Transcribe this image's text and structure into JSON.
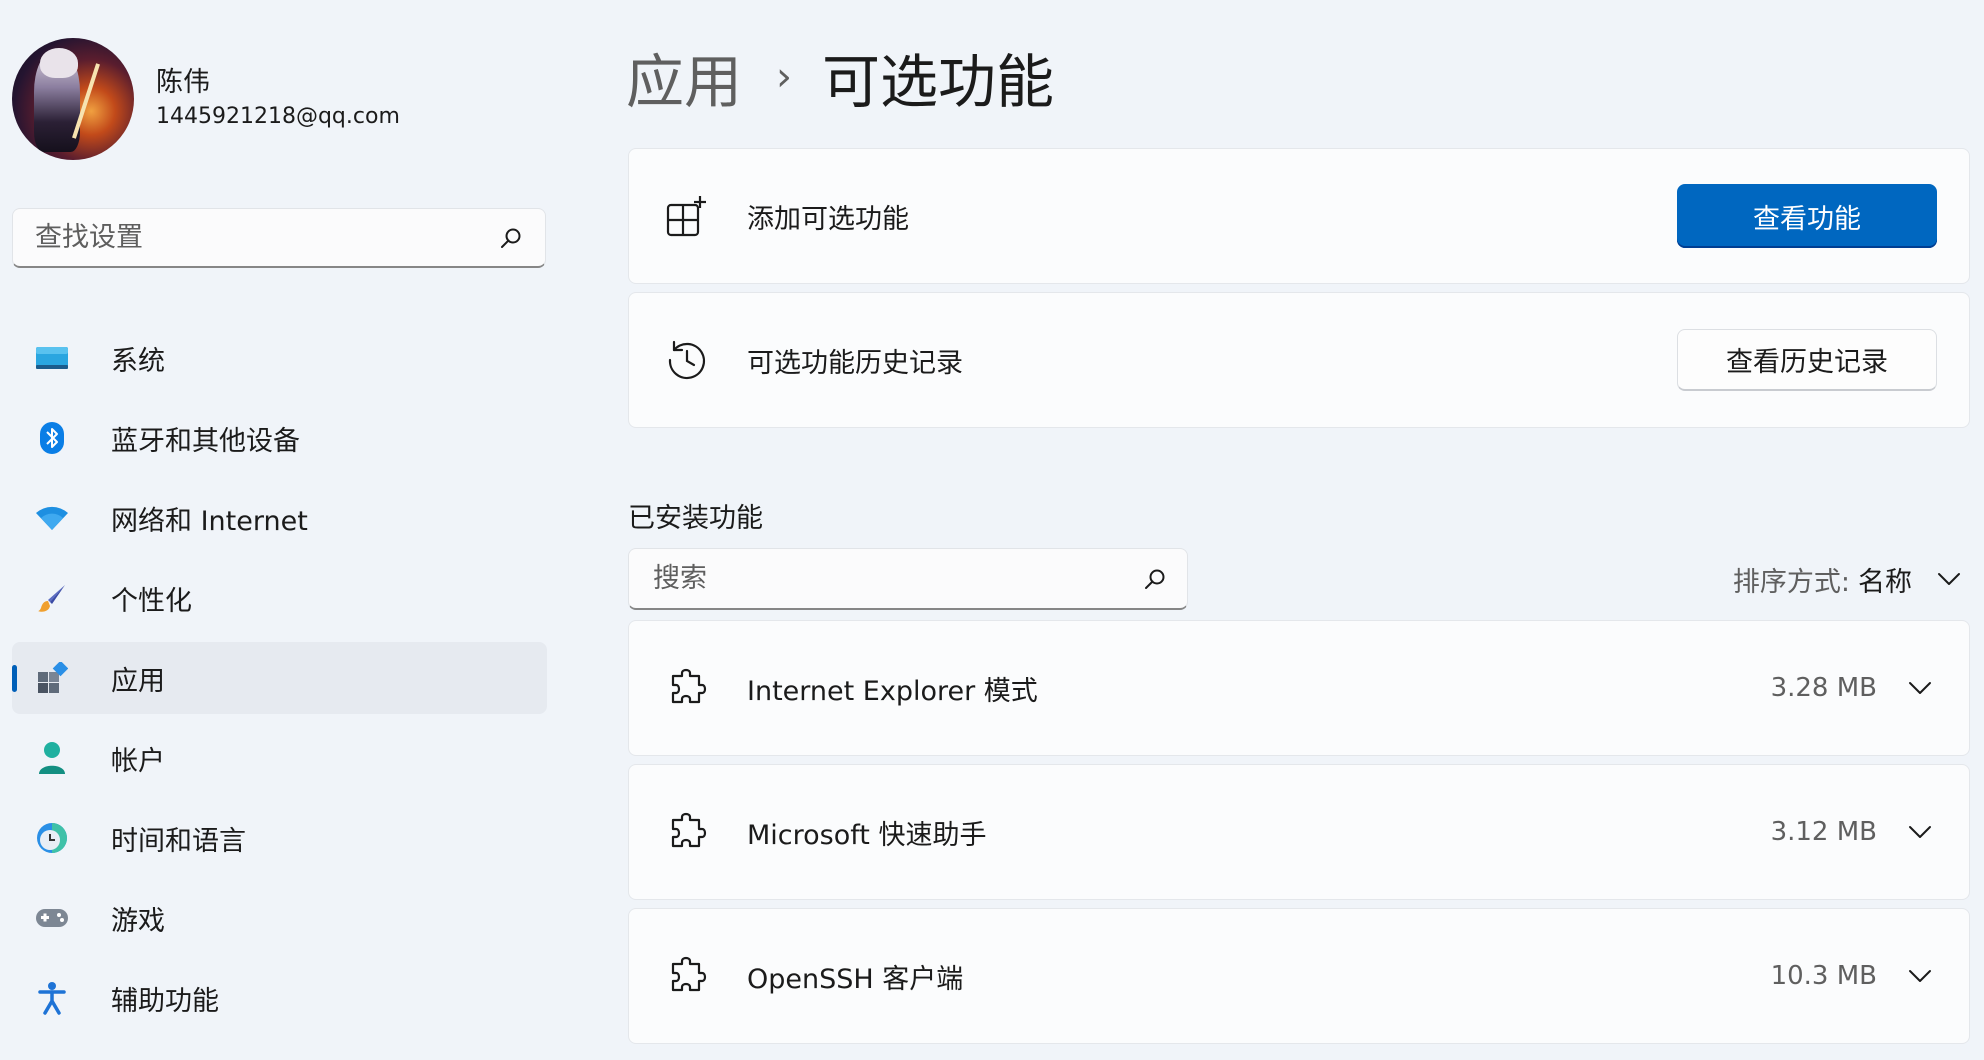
{
  "user": {
    "name": "陈伟",
    "email": "1445921218@qq.com"
  },
  "sidebar_search": {
    "placeholder": "查找设置"
  },
  "nav": [
    {
      "label": "系统",
      "icon": "system-display-icon"
    },
    {
      "label": "蓝牙和其他设备",
      "icon": "bluetooth-icon"
    },
    {
      "label": "网络和 Internet",
      "icon": "wifi-icon"
    },
    {
      "label": "个性化",
      "icon": "paintbrush-icon"
    },
    {
      "label": "应用",
      "icon": "apps-icon",
      "active": true
    },
    {
      "label": "帐户",
      "icon": "account-icon"
    },
    {
      "label": "时间和语言",
      "icon": "time-language-icon"
    },
    {
      "label": "游戏",
      "icon": "gamepad-icon"
    },
    {
      "label": "辅助功能",
      "icon": "accessibility-icon"
    }
  ],
  "breadcrumb": {
    "parent": "应用",
    "separator": "›",
    "current": "可选功能"
  },
  "add_feature": {
    "label": "添加可选功能",
    "button": "查看功能",
    "icon": "add-feature-icon"
  },
  "history": {
    "label": "可选功能历史记录",
    "button": "查看历史记录",
    "icon": "history-icon"
  },
  "installed": {
    "title": "已安装功能",
    "search_placeholder": "搜索",
    "sort_label": "排序方式:",
    "sort_value": "名称",
    "features": [
      {
        "name": "Internet Explorer 模式",
        "size": "3.28 MB",
        "icon": "puzzle-icon"
      },
      {
        "name": "Microsoft 快速助手",
        "size": "3.12 MB",
        "icon": "puzzle-icon"
      },
      {
        "name": "OpenSSH 客户端",
        "size": "10.3 MB",
        "icon": "puzzle-icon"
      }
    ]
  },
  "colors": {
    "accent": "#0067c0",
    "background": "#f0f4f9",
    "card": "#fbfcfd",
    "active_nav": "#e6eaf0"
  }
}
